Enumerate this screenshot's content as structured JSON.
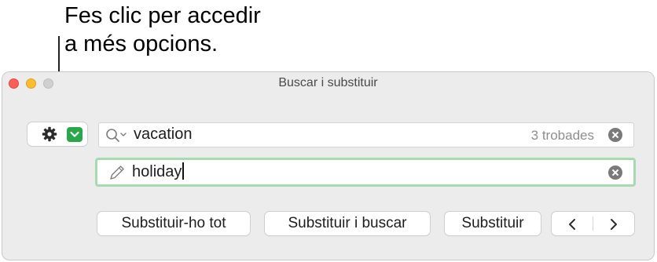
{
  "callout": {
    "text": "Fes clic per accedir\na més opcions."
  },
  "window": {
    "title": "Buscar i substituir"
  },
  "find": {
    "value": "vacation",
    "match_count": "3 trobades"
  },
  "replace": {
    "value": "holiday"
  },
  "buttons": {
    "replace_all": "Substituir-ho tot",
    "replace_and_find": "Substituir i buscar",
    "replace": "Substituir"
  },
  "icons": {
    "options": "gear-icon",
    "options_menu": "chevron-down-icon",
    "find_field": "search-icon",
    "replace_field": "pencil-icon",
    "clear": "clear-icon",
    "prev": "chevron-left-icon",
    "next": "chevron-right-icon"
  },
  "colors": {
    "accent_green": "#2aa74a",
    "focus_ring": "#a8d9b1",
    "close": "#ff5f57",
    "minimize": "#febc2e"
  }
}
